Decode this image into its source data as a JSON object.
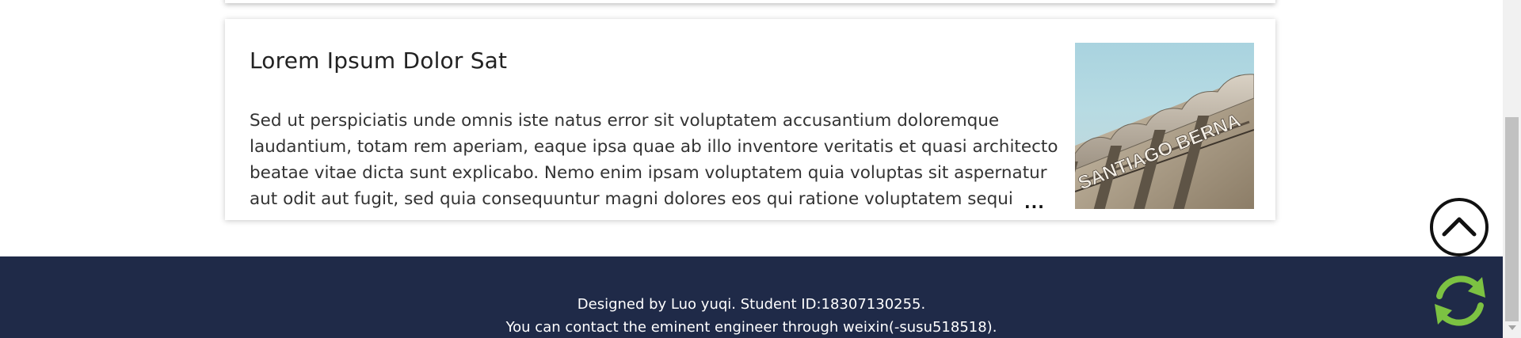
{
  "article": {
    "title": "Lorem Ipsum Dolor Sat",
    "body": "Sed ut perspiciatis unde omnis iste natus error sit voluptatem accusantium doloremque laudantium, totam rem aperiam, eaque ipsa quae ab illo inventore veritatis et quasi architecto beatae vitae dicta sunt explicabo. Nemo enim ipsam voluptatem quia voluptas sit aspernatur aut odit aut fugit, sed quia consequuntur magni dolores eos qui ratione voluptatem sequi",
    "more": "...",
    "image_sign_text": "SANTIAGO BERNA"
  },
  "footer": {
    "line1": "Designed by Luo yuqi. Student ID:18307130255.",
    "line2": "You can contact the eminent engineer through weixin(-susu518518)."
  },
  "controls": {
    "back_to_top_icon": "chevron-up-icon",
    "refresh_icon": "refresh-icon"
  },
  "colors": {
    "footer_bg": "#1f2a48",
    "refresh_green": "#7cc242",
    "text_dark": "#222222"
  }
}
